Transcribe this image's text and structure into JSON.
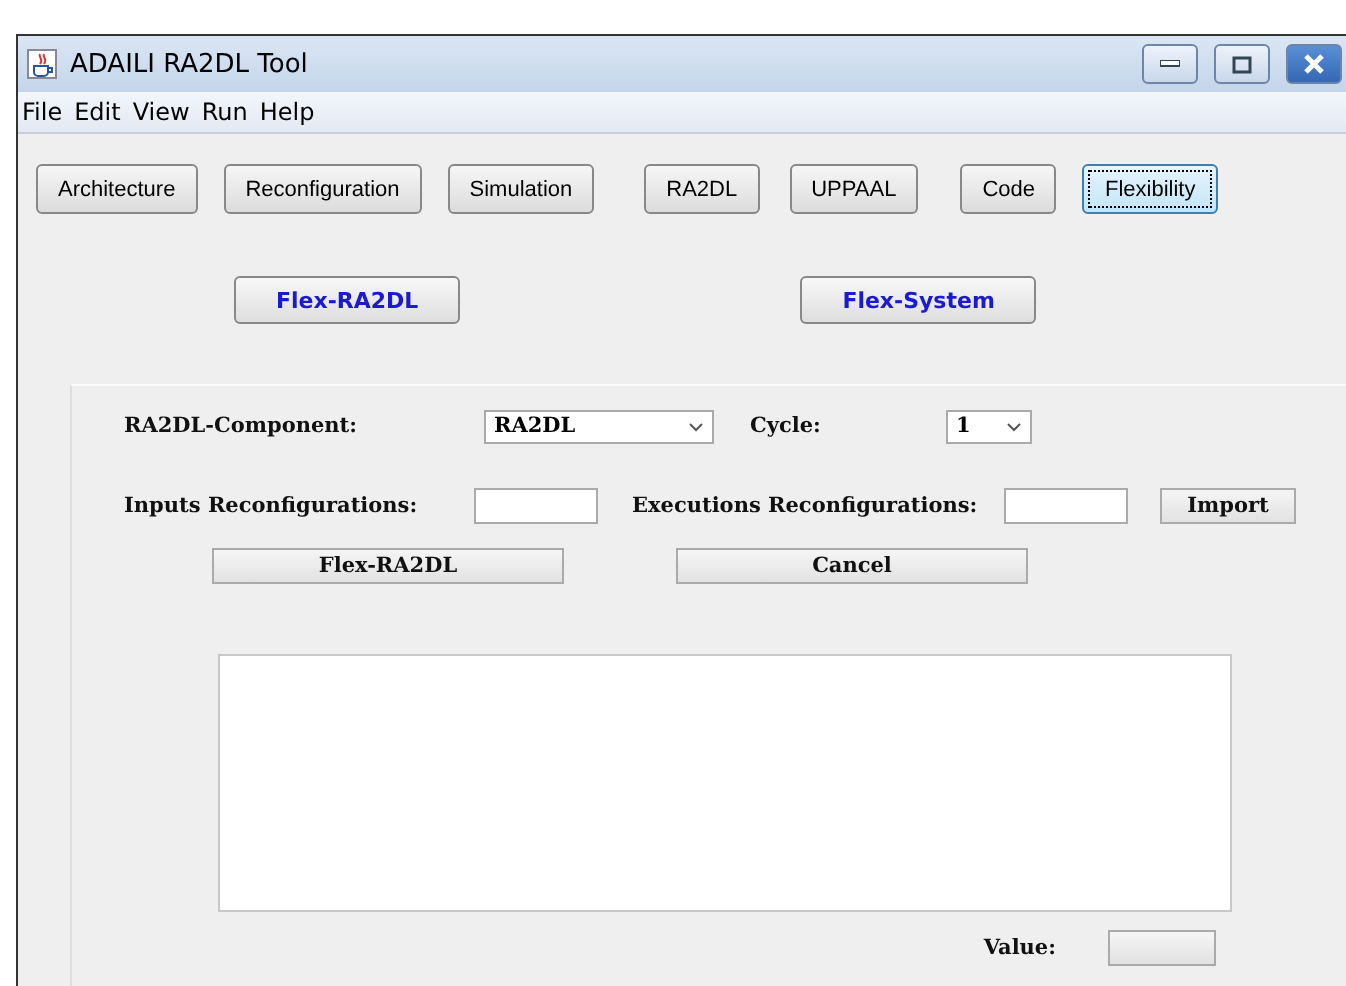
{
  "window": {
    "title": "ADAILI RA2DL Tool"
  },
  "menu": [
    "File",
    "Edit",
    "View",
    "Run",
    "Help"
  ],
  "toolbar": [
    {
      "label": "Architecture",
      "selected": false
    },
    {
      "label": "Reconfiguration",
      "selected": false
    },
    {
      "label": "Simulation",
      "selected": false
    },
    {
      "label": "RA2DL",
      "selected": false
    },
    {
      "label": "UPPAAL",
      "selected": false
    },
    {
      "label": "Code",
      "selected": false
    },
    {
      "label": "Flexibility",
      "selected": true
    }
  ],
  "modes": [
    "Flex-RA2DL",
    "Flex-System"
  ],
  "form": {
    "component_label": "RA2DL-Component:",
    "component_value": "RA2DL",
    "cycle_label": "Cycle:",
    "cycle_value": "1",
    "inputs_label": "Inputs Reconfigurations:",
    "executions_label": "Executions Reconfigurations:",
    "import_button": "Import",
    "run_button": "Flex-RA2DL",
    "cancel_button": "Cancel",
    "value_label": "Value:"
  }
}
